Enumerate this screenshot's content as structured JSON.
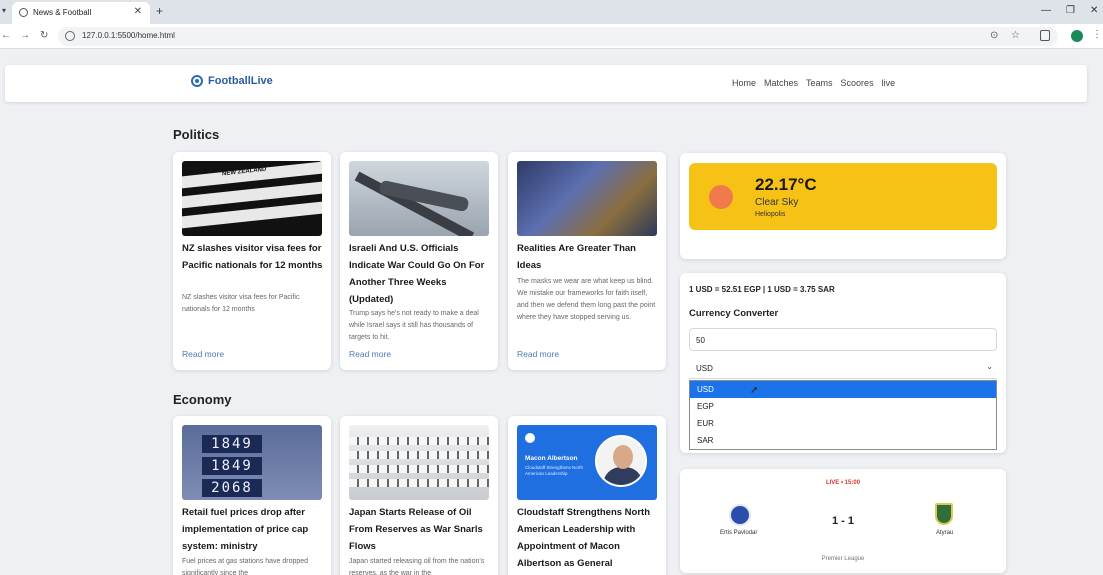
{
  "browser": {
    "tab_title": "News & Football",
    "url": "127.0.0.1:5500/home.html"
  },
  "site": {
    "brand": "FootballLive",
    "nav": [
      "Home",
      "Matches",
      "Teams",
      "Scoores",
      "live"
    ]
  },
  "sections": [
    {
      "title": "Politics",
      "cards": [
        {
          "title": "NZ slashes visitor visa fees for Pacific nationals for 12 months",
          "desc": "NZ slashes visitor visa fees for Pacific nationals for 12 months",
          "more": "Read more"
        },
        {
          "title": "Israeli And U.S. Officials Indicate War Could Go On For Another Three Weeks (Updated)",
          "desc": "Trump says he's not ready to make a deal while Israel says it still has thousands of targets to hit.",
          "more": "Read more"
        },
        {
          "title": "Realities Are Greater Than Ideas",
          "desc": "The masks we wear are what keep us blind. We mistake our frameworks for faith itself, and then we defend them long past the point where they have stopped serving us.",
          "more": "Read more"
        }
      ]
    },
    {
      "title": "Economy",
      "cards": [
        {
          "title": "Retail fuel prices drop after implementation of price cap system: ministry",
          "desc": "Fuel prices at gas stations have dropped significantly since the"
        },
        {
          "title": "Japan Starts Release of Oil From Reserves as War Snarls Flows",
          "desc": "Japan started releasing oil from the nation's reserves, as the war in the"
        },
        {
          "title": "Cloudstaff Strengthens North American Leadership with Appointment of Macon Albertson as General",
          "desc": ""
        }
      ]
    }
  ],
  "image_text": {
    "nz_banner": "NEW ZEALAND",
    "fuel_price": "1849",
    "fuel_price_bottom": "2068",
    "cf_name": "Macon Albertson",
    "cf_sub": "Cloudstaff Strengthens North American Leadership"
  },
  "weather": {
    "temp": "22.17°C",
    "desc": "Clear Sky",
    "city": "Heliopolis"
  },
  "currency": {
    "rates": "1 USD = 52.51 EGP | 1 USD = 3.75 SAR",
    "title": "Currency Converter",
    "amount": "50",
    "selected": "USD",
    "options": [
      "USD",
      "EGP",
      "EUR",
      "SAR"
    ]
  },
  "match": {
    "status": "LIVE • 15:00",
    "home": "Ertis Pavlodar",
    "away": "Atyrau",
    "score": "1 - 1",
    "league": "Premier League"
  },
  "colors": {
    "accent": "#2b5c9e",
    "weather_bg": "#f6c216",
    "live_red": "#dd3333",
    "select_blue": "#1a73e8"
  }
}
